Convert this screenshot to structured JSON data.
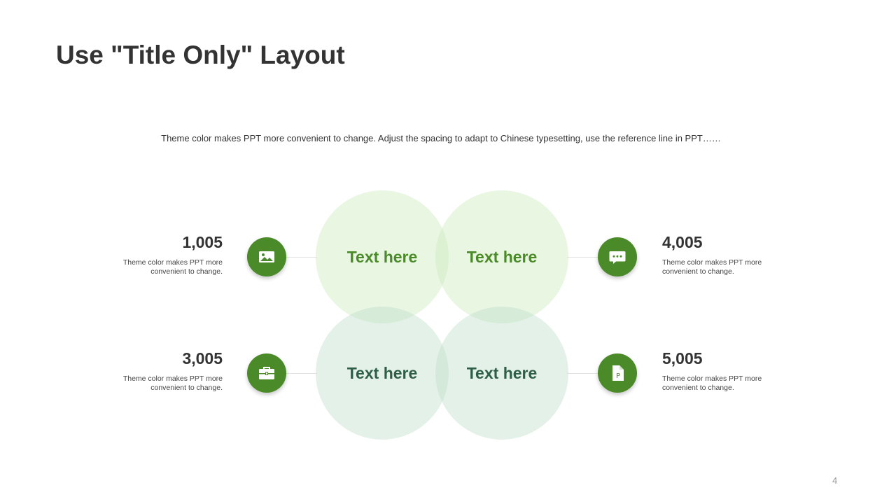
{
  "slide": {
    "title": "Use \"Title Only\" Layout",
    "subtitle": "Theme color makes PPT more convenient  to change.  Adjust the spacing to adapt to Chinese  typesetting, use the reference line in PPT……",
    "page_number": "4"
  },
  "colors": {
    "accent": "#4a8a28",
    "top_circle": "#e6f4dd",
    "bottom_circle": "#e2f0e6",
    "dark_green": "#2e5e45"
  },
  "circles": [
    {
      "label": "Text here"
    },
    {
      "label": "Text here"
    },
    {
      "label": "Text here"
    },
    {
      "label": "Text here"
    }
  ],
  "stats": [
    {
      "value": "1,005",
      "desc": "Theme  color makes PPT more convenient  to change.",
      "icon": "image-icon"
    },
    {
      "value": "4,005",
      "desc": "Theme  color makes PPT more convenient  to change.",
      "icon": "chat-icon"
    },
    {
      "value": "3,005",
      "desc": "Theme  color makes PPT more convenient  to change.",
      "icon": "briefcase-icon"
    },
    {
      "value": "5,005",
      "desc": "Theme  color makes PPT more convenient  to change.",
      "icon": "document-p-icon"
    }
  ]
}
